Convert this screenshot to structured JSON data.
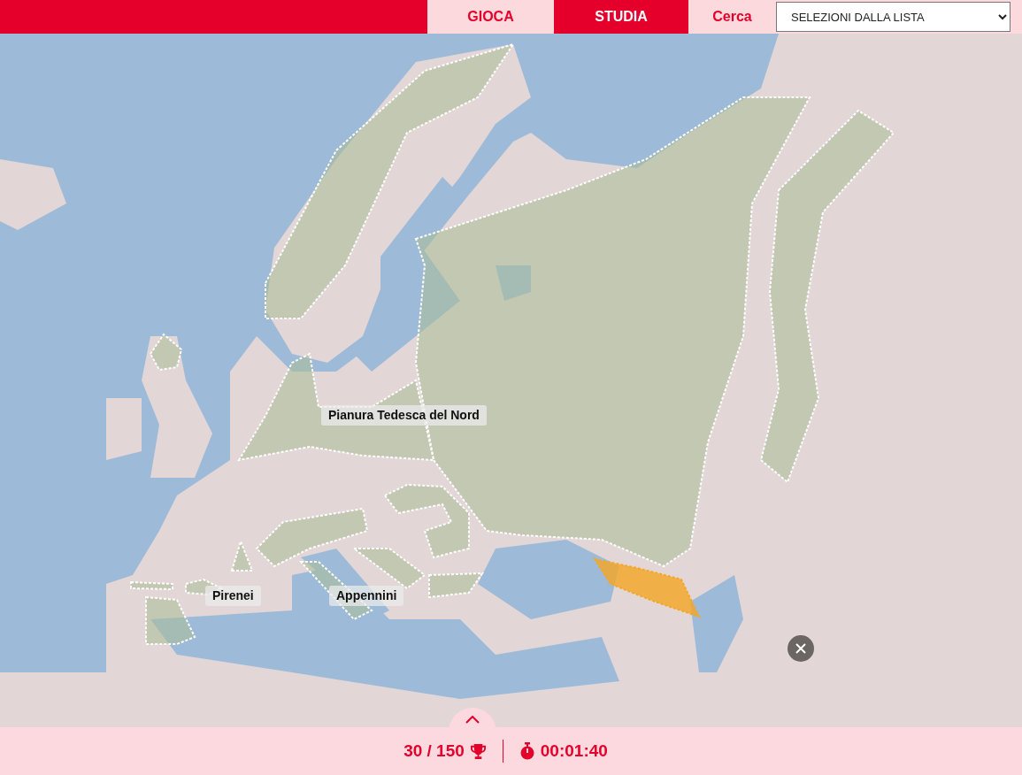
{
  "nav": {
    "tabs": [
      {
        "label": "GIOCA",
        "selected": false
      },
      {
        "label": "STUDIA",
        "selected": true
      }
    ],
    "search_label": "Cerca",
    "select": {
      "value": "SELEZIONI DALLA LISTA"
    }
  },
  "map": {
    "regions": [
      {
        "selected": false
      },
      {
        "selected": false
      },
      {
        "selected": false
      },
      {
        "selected": false
      },
      {
        "selected": false
      },
      {
        "selected": false
      },
      {
        "selected": false
      },
      {
        "selected": false
      },
      {
        "selected": false
      },
      {
        "selected": false
      },
      {
        "selected": false
      },
      {
        "selected": false
      },
      {
        "selected": false
      },
      {
        "selected": false
      },
      {
        "selected": true
      }
    ],
    "labels": [
      "Pianura Tedesca del Nord",
      "Pirenei",
      "Appennini"
    ]
  },
  "footer": {
    "score": "30 / 150",
    "timer": "00:01:40"
  }
}
